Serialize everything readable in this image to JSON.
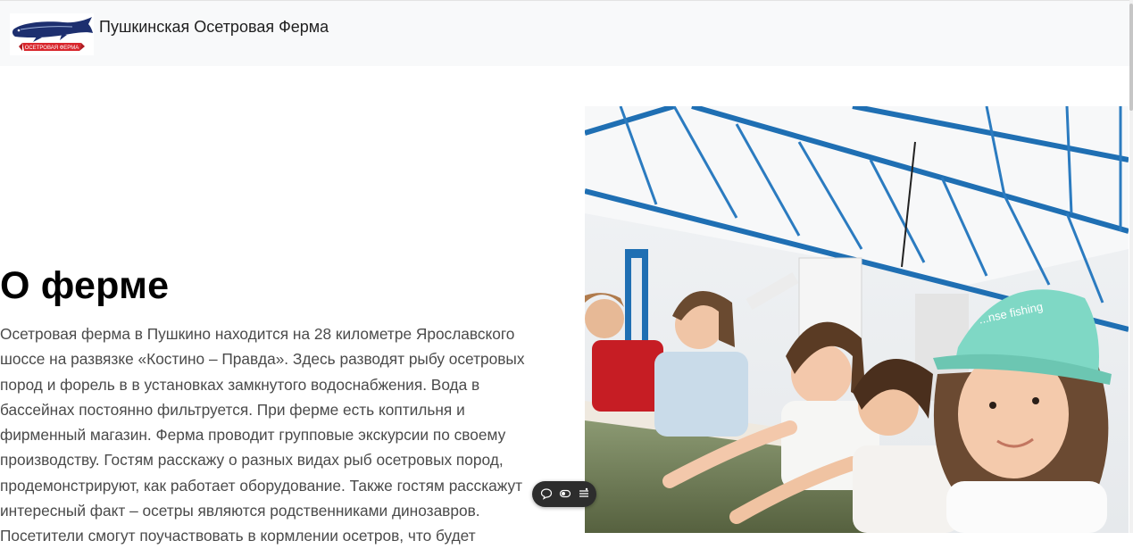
{
  "header": {
    "brand": "Пушкинская Осетровая Ферма",
    "logo_text": "ОСЕТРОВАЯ ФЕРМА",
    "logo_icon": "sturgeon-logo"
  },
  "main": {
    "title": "О ферме",
    "description": "Осетровая ферма в Пушкино находится на 28 километре Ярославского шоссе на развязке «Костино – Правда». Здесь разводят рыбу осетровых пород и форель в в установках замкнутого водоснабжения. Вода в бассейнах постоянно фильтруется. При ферме есть коптильня и фирменный магазин. Ферма проводит групповые экскурсии по своему производству. Гостям расскажу о разных видах рыб осетровых пород, продемонстрируют, как работает оборудование. Также гостям расскажут интересный факт – осетры являются родственниками динозавров. Посетители смогут поучаствовать в кормлении осетров, что будет",
    "photo_cap_text": "...nse fishing"
  },
  "toolbar": {
    "icons": [
      "comment-icon",
      "toggle-icon",
      "menu-icon"
    ]
  },
  "colors": {
    "navbar_bg": "#f8f9fa",
    "steel_blue": "#1f6fb3",
    "cap_mint": "#7fd8c5",
    "logo_red": "#d8262c",
    "logo_navy": "#1d2f6f"
  }
}
